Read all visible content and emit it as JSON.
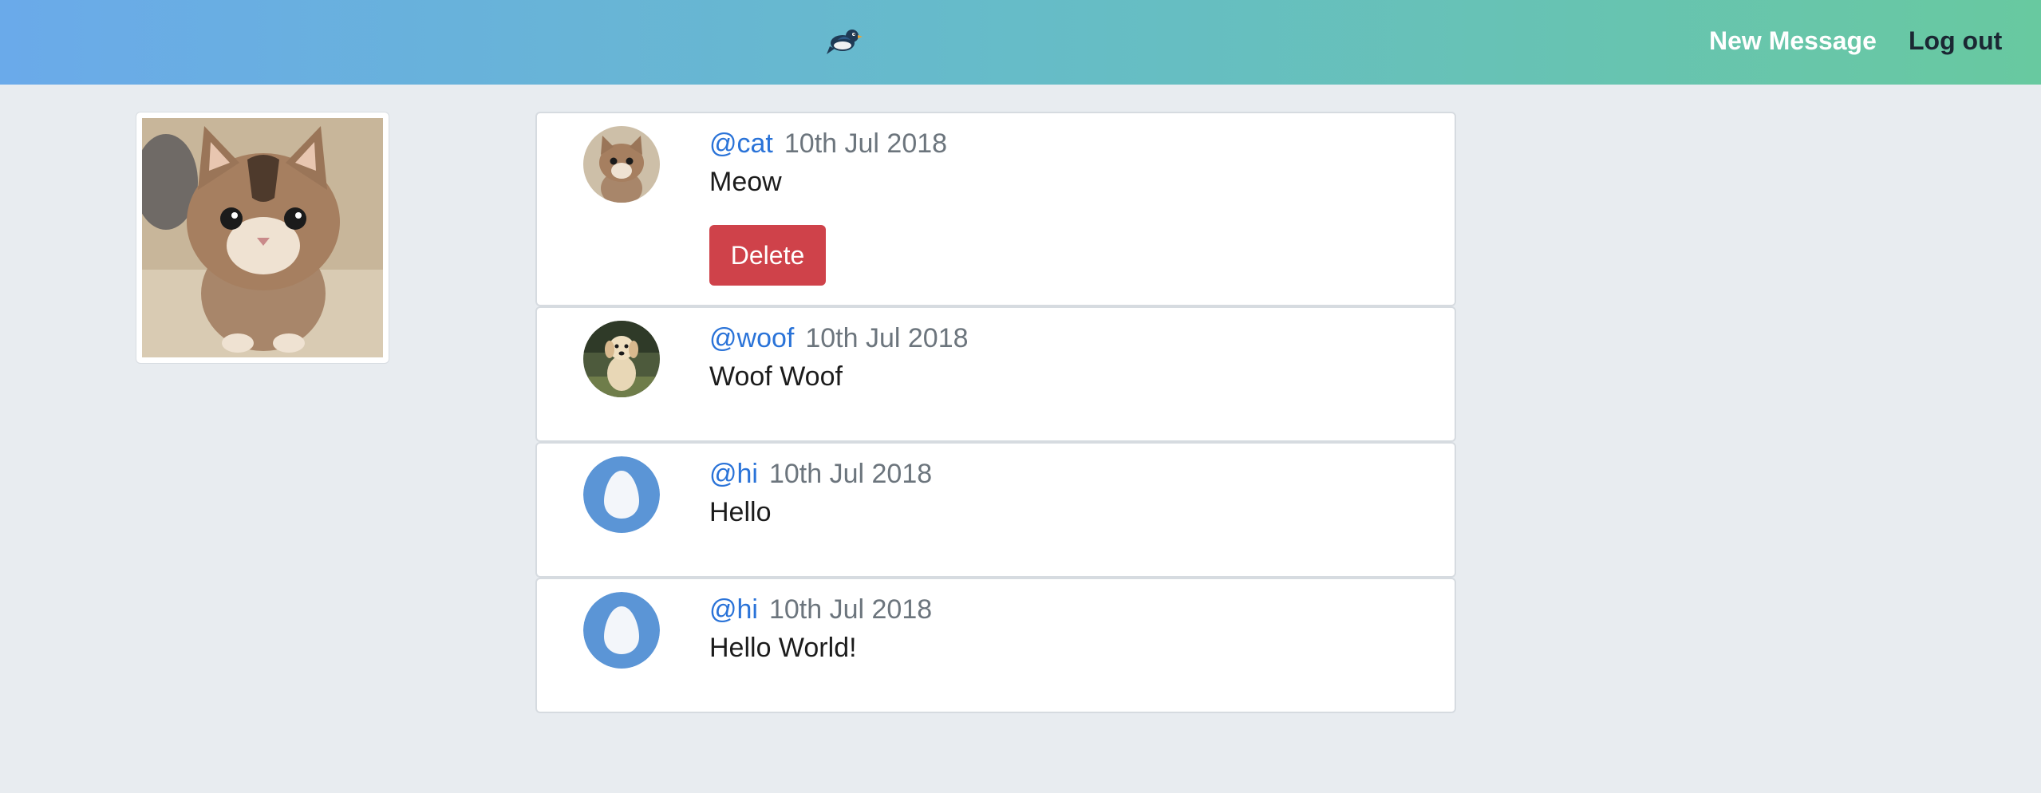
{
  "nav": {
    "logo_icon": "bird-logo-icon",
    "new_message_label": "New Message",
    "logout_label": "Log out"
  },
  "profile": {
    "image_icon": "kitten-photo"
  },
  "messages": [
    {
      "handle": "@cat",
      "date": "10th Jul 2018",
      "text": "Meow",
      "avatar": "kitten-avatar",
      "delete_label": "Delete"
    },
    {
      "handle": "@woof",
      "date": "10th Jul 2018",
      "text": "Woof Woof",
      "avatar": "puppy-avatar"
    },
    {
      "handle": "@hi",
      "date": "10th Jul 2018",
      "text": "Hello",
      "avatar": "egg-avatar"
    },
    {
      "handle": "@hi",
      "date": "10th Jul 2018",
      "text": "Hello World!",
      "avatar": "egg-avatar"
    }
  ],
  "colors": {
    "link": "#2a73d8",
    "delete": "#cf424a",
    "egg_avatar": "#5b95d6",
    "background": "#e8ecf0"
  }
}
